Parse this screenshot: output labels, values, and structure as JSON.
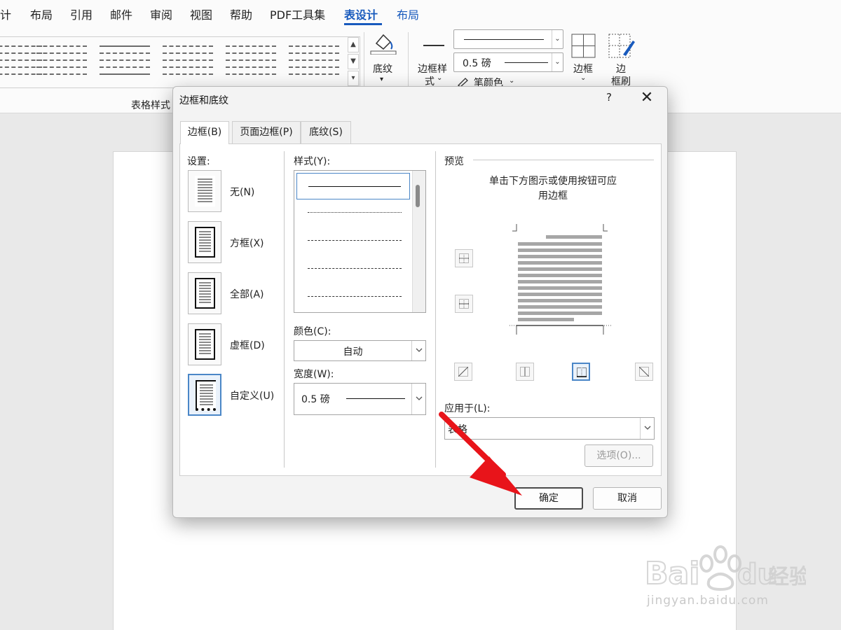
{
  "menu": {
    "items": [
      "设计",
      "布局",
      "引用",
      "邮件",
      "审阅",
      "视图",
      "帮助",
      "PDF工具集",
      "表设计",
      "布局"
    ],
    "active": "表设计"
  },
  "ribbon": {
    "group_table_styles": "表格样式",
    "shading": "底纹",
    "border_styles_line1": "边框样",
    "border_styles_line2": "式",
    "pen_weight": "0.5 磅",
    "pen_color": "笔颜色",
    "borders": "边框",
    "border_painter_line1": "边",
    "border_painter_line2": "框刷"
  },
  "dialog": {
    "title": "边框和底纹",
    "help": "?",
    "tabs": [
      "边框(B)",
      "页面边框(P)",
      "底纹(S)"
    ],
    "active_tab": "边框(B)",
    "settings_label": "设置:",
    "settings": [
      "无(N)",
      "方框(X)",
      "全部(A)",
      "虚框(D)",
      "自定义(U)"
    ],
    "selected_setting": "自定义(U)",
    "style_label": "样式(Y):",
    "color_label": "颜色(C):",
    "color_value": "自动",
    "width_label": "宽度(W):",
    "width_value": "0.5 磅",
    "preview_label": "预览",
    "preview_hint_line1": "单击下方图示或使用按钮可应",
    "preview_hint_line2": "用边框",
    "apply_to_label": "应用于(L):",
    "apply_to_value": "表格",
    "options_button": "选项(O)...",
    "ok_button": "确定",
    "cancel_button": "取消"
  },
  "watermark": {
    "brand": "Bai du 经验",
    "url": "jingyan.baidu.com"
  },
  "colors": {
    "accent": "#185abd",
    "selection": "#4a86c7",
    "arrow": "#e8141a"
  }
}
